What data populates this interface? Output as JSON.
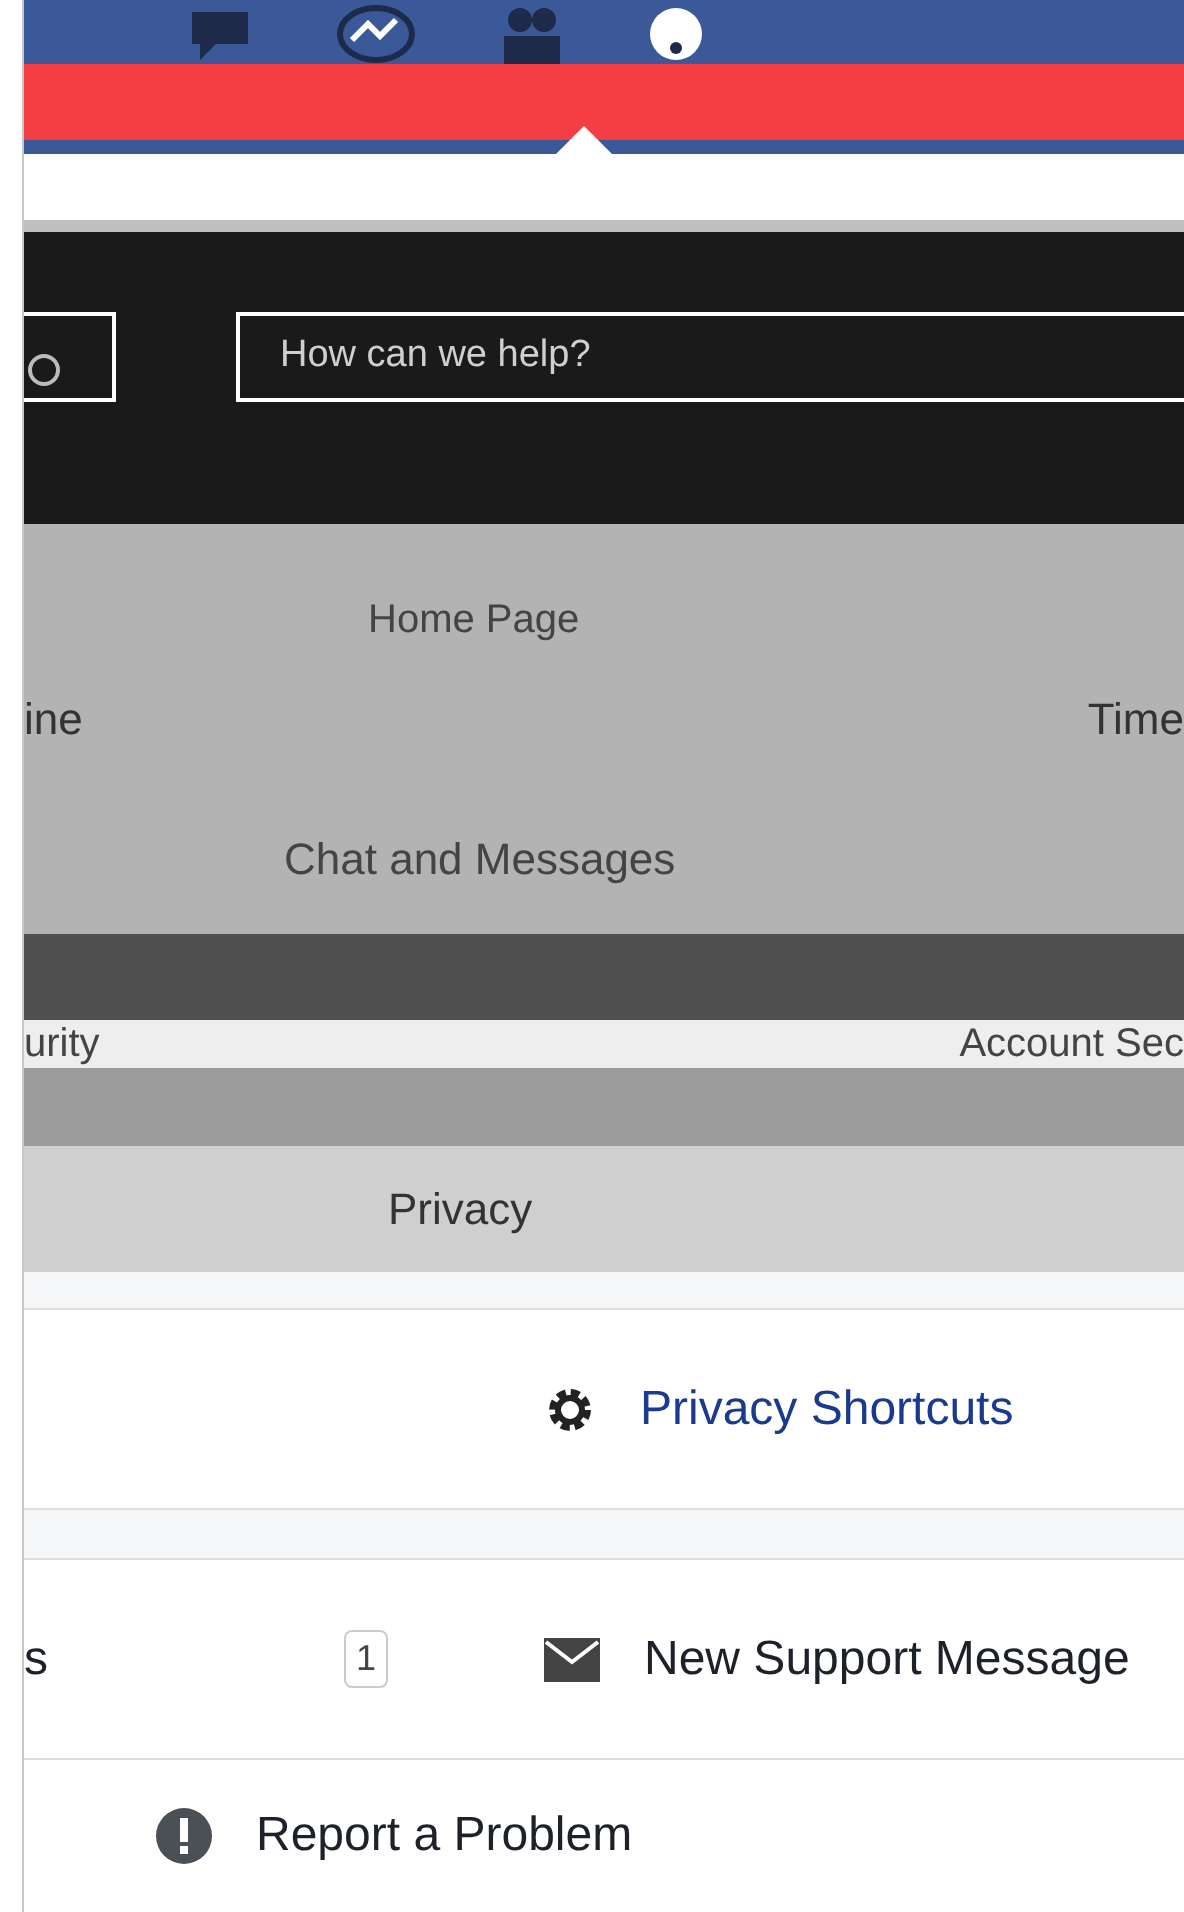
{
  "search": {
    "placeholder": "How can we help?"
  },
  "topics": {
    "home": "Home Page",
    "timeline_left": "ine",
    "timeline_right": "Time",
    "chat": "Chat and Messages",
    "security_left": "urity",
    "security_right": "Account Sec",
    "privacy": "Privacy"
  },
  "links": [
    {
      "kind": "gear",
      "label": "Privacy Shortcuts"
    },
    {
      "kind": "mail",
      "label": "New Support Message",
      "side_text": "s",
      "badge": "1"
    },
    {
      "kind": "alert",
      "label": "Report a Problem"
    }
  ]
}
